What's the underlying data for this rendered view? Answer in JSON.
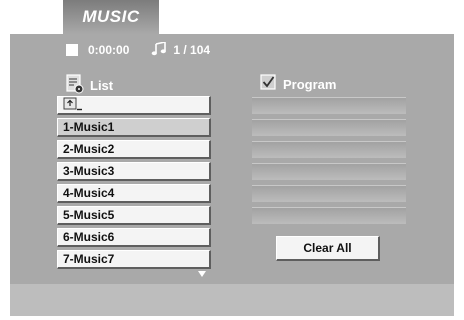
{
  "tab": {
    "label": "MUSIC"
  },
  "status": {
    "time": "0:00:00",
    "track": "1 / 104"
  },
  "list": {
    "header": "List",
    "items": [
      {
        "label": "1-Music1",
        "selected": true
      },
      {
        "label": "2-Music2"
      },
      {
        "label": "3-Music3"
      },
      {
        "label": "4-Music4"
      },
      {
        "label": "5-Music5"
      },
      {
        "label": "6-Music6"
      },
      {
        "label": "7-Music7"
      }
    ]
  },
  "program": {
    "header": "Program",
    "clear_label": "Clear All"
  },
  "icons": {
    "stop": "stop-icon",
    "track": "music-note-icon",
    "list": "list-icon",
    "program": "checkbox-icon",
    "up_folder": "up-folder-icon",
    "scroll": "scroll-down-icon"
  }
}
